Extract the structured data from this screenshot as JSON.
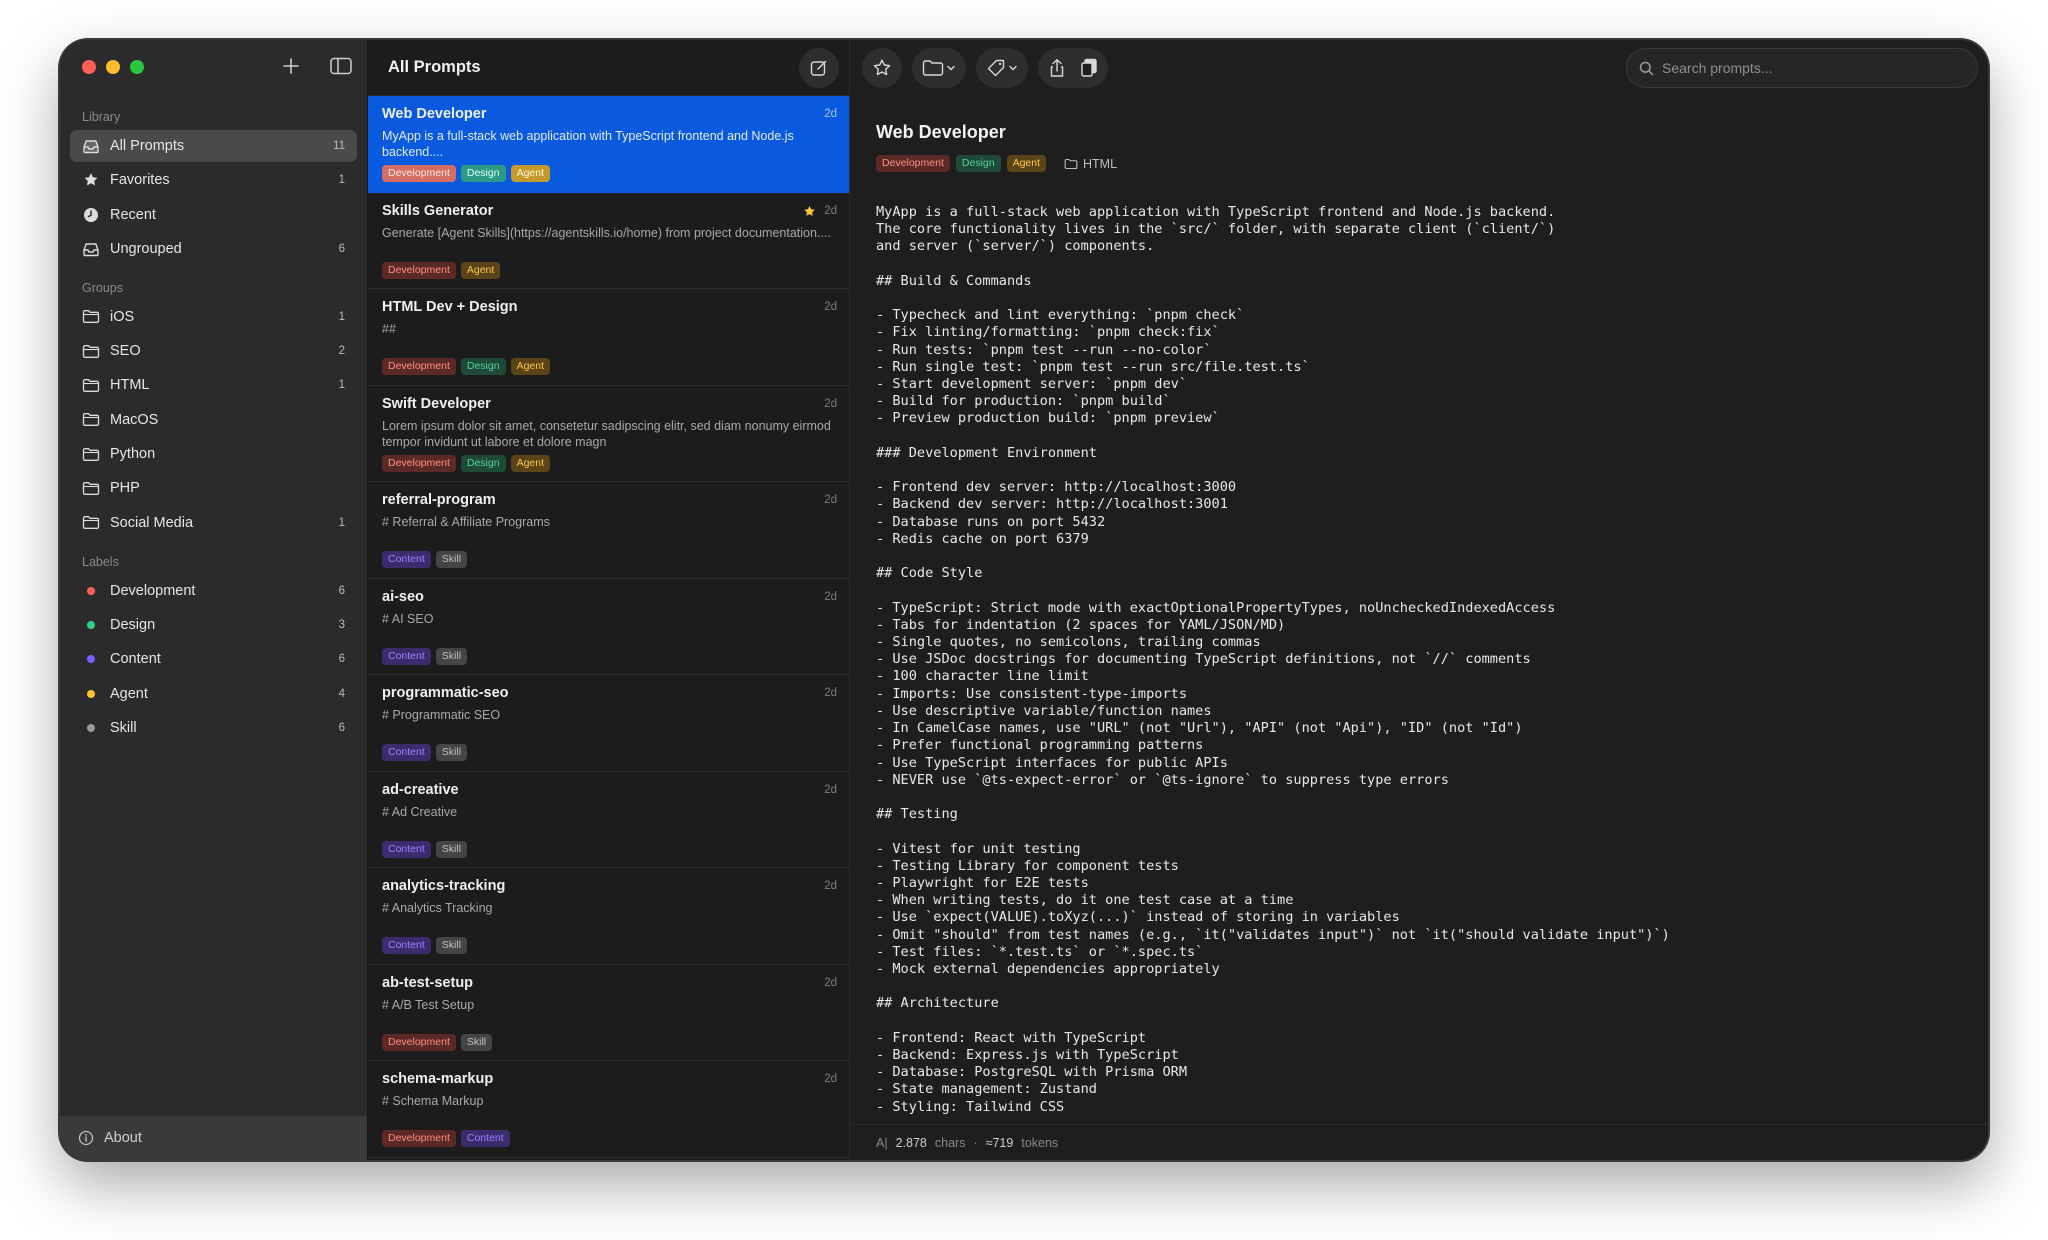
{
  "sidebar": {
    "sections": {
      "library": "Library",
      "groups": "Groups",
      "labels": "Labels"
    },
    "library": [
      {
        "label": "All Prompts",
        "count": "11",
        "icon": "tray-icon"
      },
      {
        "label": "Favorites",
        "count": "1",
        "icon": "star-icon"
      },
      {
        "label": "Recent",
        "count": "",
        "icon": "clock-icon"
      },
      {
        "label": "Ungrouped",
        "count": "6",
        "icon": "inbox-icon"
      }
    ],
    "groups": [
      {
        "label": "iOS",
        "count": "1"
      },
      {
        "label": "SEO",
        "count": "2"
      },
      {
        "label": "HTML",
        "count": "1"
      },
      {
        "label": "MacOS",
        "count": ""
      },
      {
        "label": "Python",
        "count": ""
      },
      {
        "label": "PHP",
        "count": ""
      },
      {
        "label": "Social Media",
        "count": "1"
      }
    ],
    "labels": [
      {
        "label": "Development",
        "count": "6",
        "color": "#ff5f57"
      },
      {
        "label": "Design",
        "count": "3",
        "color": "#2fd18a"
      },
      {
        "label": "Content",
        "count": "6",
        "color": "#7c5cff"
      },
      {
        "label": "Agent",
        "count": "4",
        "color": "#ffc233"
      },
      {
        "label": "Skill",
        "count": "6",
        "color": "#9a9a9a"
      }
    ],
    "footer": "About"
  },
  "list": {
    "title": "All Prompts",
    "items": [
      {
        "title": "Web Developer",
        "age": "2d",
        "desc": "MyApp is a full-stack web application with TypeScript frontend and Node.js backend....",
        "tags": [
          "Development",
          "Design",
          "Agent"
        ]
      },
      {
        "title": "Skills Generator",
        "age": "2d",
        "desc": "Generate [Agent Skills](https://agentskills.io/home) from project documentation....",
        "tags": [
          "Development",
          "Agent"
        ]
      },
      {
        "title": "HTML Dev + Design",
        "age": "2d",
        "desc": "##",
        "tags": [
          "Development",
          "Design",
          "Agent"
        ]
      },
      {
        "title": "Swift Developer",
        "age": "2d",
        "desc": "Lorem ipsum dolor sit amet, consetetur sadipscing elitr, sed diam nonumy eirmod tempor invidunt ut labore et dolore magn",
        "tags": [
          "Development",
          "Design",
          "Agent"
        ]
      },
      {
        "title": "referral-program",
        "age": "2d",
        "desc": "# Referral & Affiliate Programs",
        "tags": [
          "Content",
          "Skill"
        ]
      },
      {
        "title": "ai-seo",
        "age": "2d",
        "desc": "# AI SEO",
        "tags": [
          "Content",
          "Skill"
        ]
      },
      {
        "title": "programmatic-seo",
        "age": "2d",
        "desc": "# Programmatic SEO",
        "tags": [
          "Content",
          "Skill"
        ]
      },
      {
        "title": "ad-creative",
        "age": "2d",
        "desc": "# Ad Creative",
        "tags": [
          "Content",
          "Skill"
        ]
      },
      {
        "title": "analytics-tracking",
        "age": "2d",
        "desc": "# Analytics Tracking",
        "tags": [
          "Content",
          "Skill"
        ]
      },
      {
        "title": "ab-test-setup",
        "age": "2d",
        "desc": "# A/B Test Setup",
        "tags": [
          "Development",
          "Skill"
        ]
      },
      {
        "title": "schema-markup",
        "age": "2d",
        "desc": "# Schema Markup",
        "tags": [
          "Development",
          "Content"
        ]
      }
    ]
  },
  "search": {
    "placeholder": "Search prompts..."
  },
  "detail": {
    "title": "Web Developer",
    "tags": [
      "Development",
      "Design",
      "Agent"
    ],
    "group": "HTML",
    "body": "MyApp is a full-stack web application with TypeScript frontend and Node.js backend.\nThe core functionality lives in the `src/` folder, with separate client (`client/`)\nand server (`server/`) components.\n\n## Build & Commands\n\n- Typecheck and lint everything: `pnpm check`\n- Fix linting/formatting: `pnpm check:fix`\n- Run tests: `pnpm test --run --no-color`\n- Run single test: `pnpm test --run src/file.test.ts`\n- Start development server: `pnpm dev`\n- Build for production: `pnpm build`\n- Preview production build: `pnpm preview`\n\n### Development Environment\n\n- Frontend dev server: http://localhost:3000\n- Backend dev server: http://localhost:3001\n- Database runs on port 5432\n- Redis cache on port 6379\n\n## Code Style\n\n- TypeScript: Strict mode with exactOptionalPropertyTypes, noUncheckedIndexedAccess\n- Tabs for indentation (2 spaces for YAML/JSON/MD)\n- Single quotes, no semicolons, trailing commas\n- Use JSDoc docstrings for documenting TypeScript definitions, not `//` comments\n- 100 character line limit\n- Imports: Use consistent-type-imports\n- Use descriptive variable/function names\n- In CamelCase names, use \"URL\" (not \"Url\"), \"API\" (not \"Api\"), \"ID\" (not \"Id\")\n- Prefer functional programming patterns\n- Use TypeScript interfaces for public APIs\n- NEVER use `@ts-expect-error` or `@ts-ignore` to suppress type errors\n\n## Testing\n\n- Vitest for unit testing\n- Testing Library for component tests\n- Playwright for E2E tests\n- When writing tests, do it one test case at a time\n- Use `expect(VALUE).toXyz(...)` instead of storing in variables\n- Omit \"should\" from test names (e.g., `it(\"validates input\")` not `it(\"should validate input\")`)\n- Test files: `*.test.ts` or `*.spec.ts`\n- Mock external dependencies appropriately\n\n## Architecture\n\n- Frontend: React with TypeScript\n- Backend: Express.js with TypeScript\n- Database: PostgreSQL with Prisma ORM\n- State management: Zustand\n- Styling: Tailwind CSS",
    "status": {
      "chars": "2.878",
      "chars_label": "chars",
      "sep": "·",
      "tokens": "≈719",
      "tokens_label": "tokens",
      "prefix": "A|"
    }
  }
}
